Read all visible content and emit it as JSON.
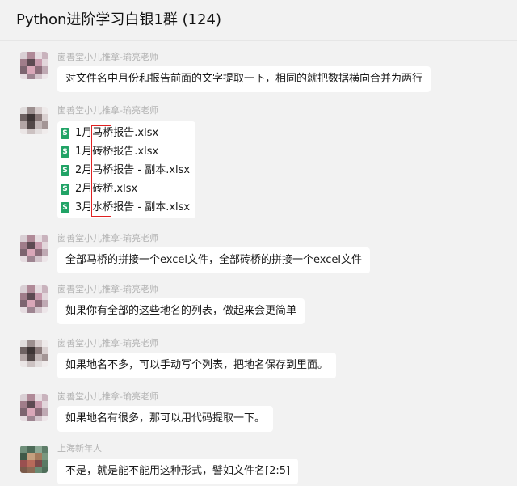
{
  "window": {
    "title": "Python进阶学习白银1群 (124)"
  },
  "messages": [
    {
      "sender": "崮善堂小儿推拿-瑜亮老师",
      "text": "对文件名中月份和报告前面的文字提取一下，相同的就把数据横向合并为两行"
    },
    {
      "sender": "崮善堂小儿推拿-瑜亮老师",
      "files": [
        {
          "icon": "S",
          "name": "1月马桥报告.xlsx"
        },
        {
          "icon": "S",
          "name": "1月砖桥报告.xlsx"
        },
        {
          "icon": "S",
          "name": "2月马桥报告 - 副本.xlsx"
        },
        {
          "icon": "S",
          "name": "2月砖桥.xlsx"
        },
        {
          "icon": "S",
          "name": "3月水桥报告 - 副本.xlsx"
        }
      ]
    },
    {
      "sender": "崮善堂小儿推拿-瑜亮老师",
      "text": "全部马桥的拼接一个excel文件，全部砖桥的拼接一个excel文件"
    },
    {
      "sender": "崮善堂小儿推拿-瑜亮老师",
      "text": "如果你有全部的这些地名的列表，做起来会更简单"
    },
    {
      "sender": "崮善堂小儿推拿-瑜亮老师",
      "text": "如果地名不多，可以手动写个列表，把地名保存到里面。"
    },
    {
      "sender": "崮善堂小儿推拿-瑜亮老师",
      "text": "如果地名有很多，那可以用代码提取一下。"
    },
    {
      "sender": "上海新年人",
      "text": "不是，就是能不能用这种形式，譬如文件名[2:5]"
    }
  ],
  "colors": {
    "background": "#f2f2f2",
    "bubble": "#ffffff",
    "sender_name": "#b3b3b3",
    "excel_icon": "#21a366",
    "highlight": "#e02020"
  }
}
